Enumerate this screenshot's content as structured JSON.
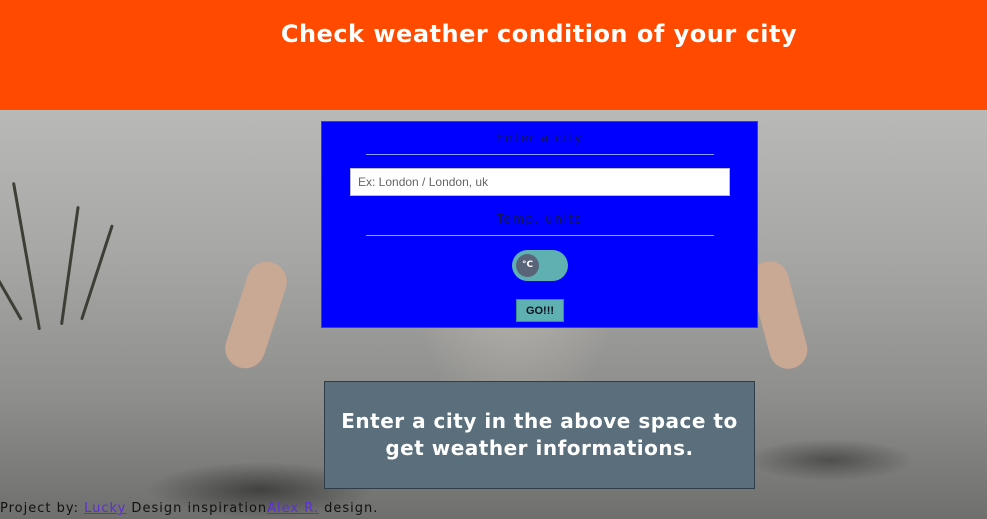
{
  "header": {
    "title": "Check weather condition of your city",
    "background_color": "#ff4a00"
  },
  "form": {
    "city_label": "Enter a city",
    "city_input": {
      "value": "",
      "placeholder": "Ex: London / London, uk"
    },
    "units_label": "Temp. units",
    "units_toggle": {
      "selected_label": "°C"
    },
    "submit_label": "GO!!!",
    "background_color": "#0000ff"
  },
  "message": {
    "text": "Enter a city in the above space to get weather informations."
  },
  "footer": {
    "project_by_text": "Project by: ",
    "author_link": "Lucky",
    "design_text": " Design inspiration",
    "inspiration_link": "Alex R.",
    "design_suffix": " design."
  }
}
